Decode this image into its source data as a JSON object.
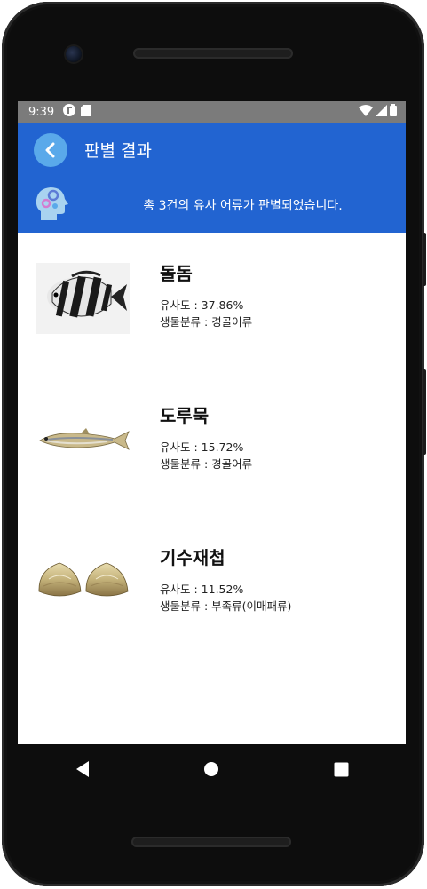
{
  "status": {
    "time": "9:39"
  },
  "appbar": {
    "title": "판별 결과"
  },
  "banner": {
    "message": "총 3건의 유사 어류가 판별되었습니다."
  },
  "results": [
    {
      "name": "돌돔",
      "similarity": "유사도 : 37.86%",
      "classification": "생물분류 : 경골어류",
      "image": "striped-fish-image"
    },
    {
      "name": "도루묵",
      "similarity": "유사도 : 15.72%",
      "classification": "생물분류 : 경골어류",
      "image": "slender-fish-image"
    },
    {
      "name": "기수재첩",
      "similarity": "유사도 : 11.52%",
      "classification": "생물분류 : 부족류(이매패류)",
      "image": "clam-shells-image"
    }
  ],
  "colors": {
    "primary": "#2264d1",
    "back_button": "#5aa9ea",
    "status_bar": "#7b7b7b"
  }
}
